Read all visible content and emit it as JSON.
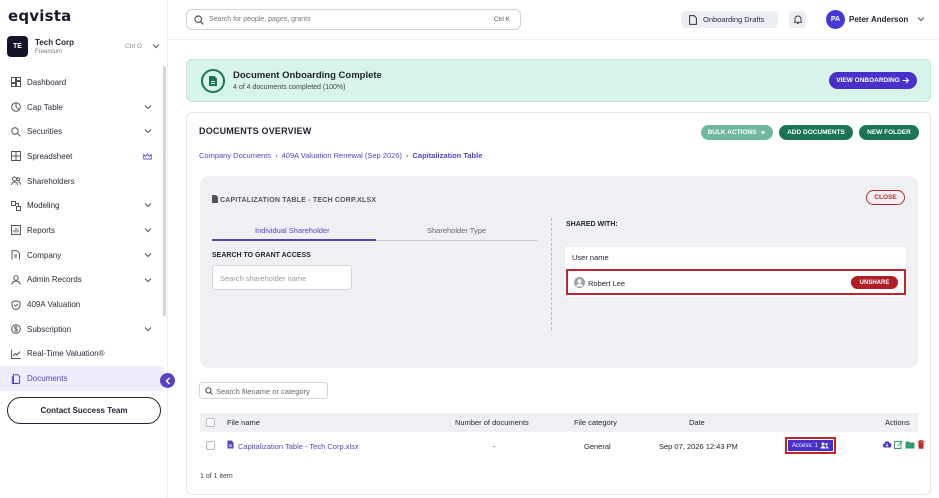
{
  "sidebar": {
    "logo": "eqvista",
    "company": {
      "initials": "TE",
      "name": "Tech Corp",
      "plan": "Freemium",
      "shortcut": "Ctrl O"
    },
    "items": [
      {
        "label": "Dashboard",
        "icon": "dashboard-icon",
        "chevron": false
      },
      {
        "label": "Cap Table",
        "icon": "pie-chart-icon",
        "chevron": true
      },
      {
        "label": "Securities",
        "icon": "securities-icon",
        "chevron": true
      },
      {
        "label": "Spreadsheet",
        "icon": "grid-icon",
        "chevron": false,
        "crown": true
      },
      {
        "label": "Shareholders",
        "icon": "users-icon",
        "chevron": false
      },
      {
        "label": "Modeling",
        "icon": "modeling-icon",
        "chevron": true
      },
      {
        "label": "Reports",
        "icon": "reports-icon",
        "chevron": true
      },
      {
        "label": "Company",
        "icon": "company-icon",
        "chevron": true
      },
      {
        "label": "Admin Records",
        "icon": "admin-records-icon",
        "chevron": true
      },
      {
        "label": "409A Valuation",
        "icon": "shield-icon",
        "chevron": false
      },
      {
        "label": "Subscription",
        "icon": "subscription-icon",
        "chevron": true
      },
      {
        "label": "Real-Time Valuation®",
        "icon": "trend-icon",
        "chevron": false
      },
      {
        "label": "Documents",
        "icon": "documents-icon",
        "chevron": false,
        "active": true
      }
    ],
    "contact_label": "Contact Success Team"
  },
  "topbar": {
    "search_placeholder": "Search for people, pages, grants",
    "search_shortcut": "Ctrl K",
    "drafts_label": "Onboarding Drafts",
    "user_initials": "PA",
    "user_name": "Peter Anderson"
  },
  "banner": {
    "title": "Document Onboarding Complete",
    "subtitle": "4 of 4 documents completed (100%)",
    "button": "VIEW ONBOARDING"
  },
  "documents": {
    "title": "DOCUMENTS OVERVIEW",
    "bulk_actions": "BULK ACTIONS",
    "add_documents": "ADD DOCUMENTS",
    "new_folder": "NEW FOLDER",
    "breadcrumb": [
      "Company Documents",
      "409A Valuation Renewal (Sep 2026)",
      "Capitalization Table"
    ]
  },
  "share_panel": {
    "file_name": "CAPITALIZATION TABLE - TECH CORP.XLSX",
    "close_label": "CLOSE",
    "tabs": [
      "Individual Shareholder",
      "Shareholder Type"
    ],
    "search_label": "SEARCH TO GRANT ACCESS",
    "search_placeholder": "Search shareholder name",
    "shared_with_label": "SHARED WITH:",
    "user_header": "User name",
    "shared_users": [
      {
        "name": "Robert Lee",
        "action": "UNSHARE"
      }
    ]
  },
  "file_table": {
    "search_placeholder": "Search filename or category",
    "headers": [
      "File name",
      "Number of documents",
      "File category",
      "Date",
      "Actions"
    ],
    "rows": [
      {
        "file_name": "Capitalization Table - Tech Corp.xlsx",
        "num_documents": "-",
        "category": "General",
        "date": "Sep 07, 2026 12:43 PM",
        "access": "Access: 1"
      }
    ],
    "count_text": "1 of 1 item"
  },
  "colors": {
    "accent": "#4a2fc9",
    "success_bg": "#d6f4ea",
    "teal": "#1a7557",
    "danger": "#c0272d"
  }
}
